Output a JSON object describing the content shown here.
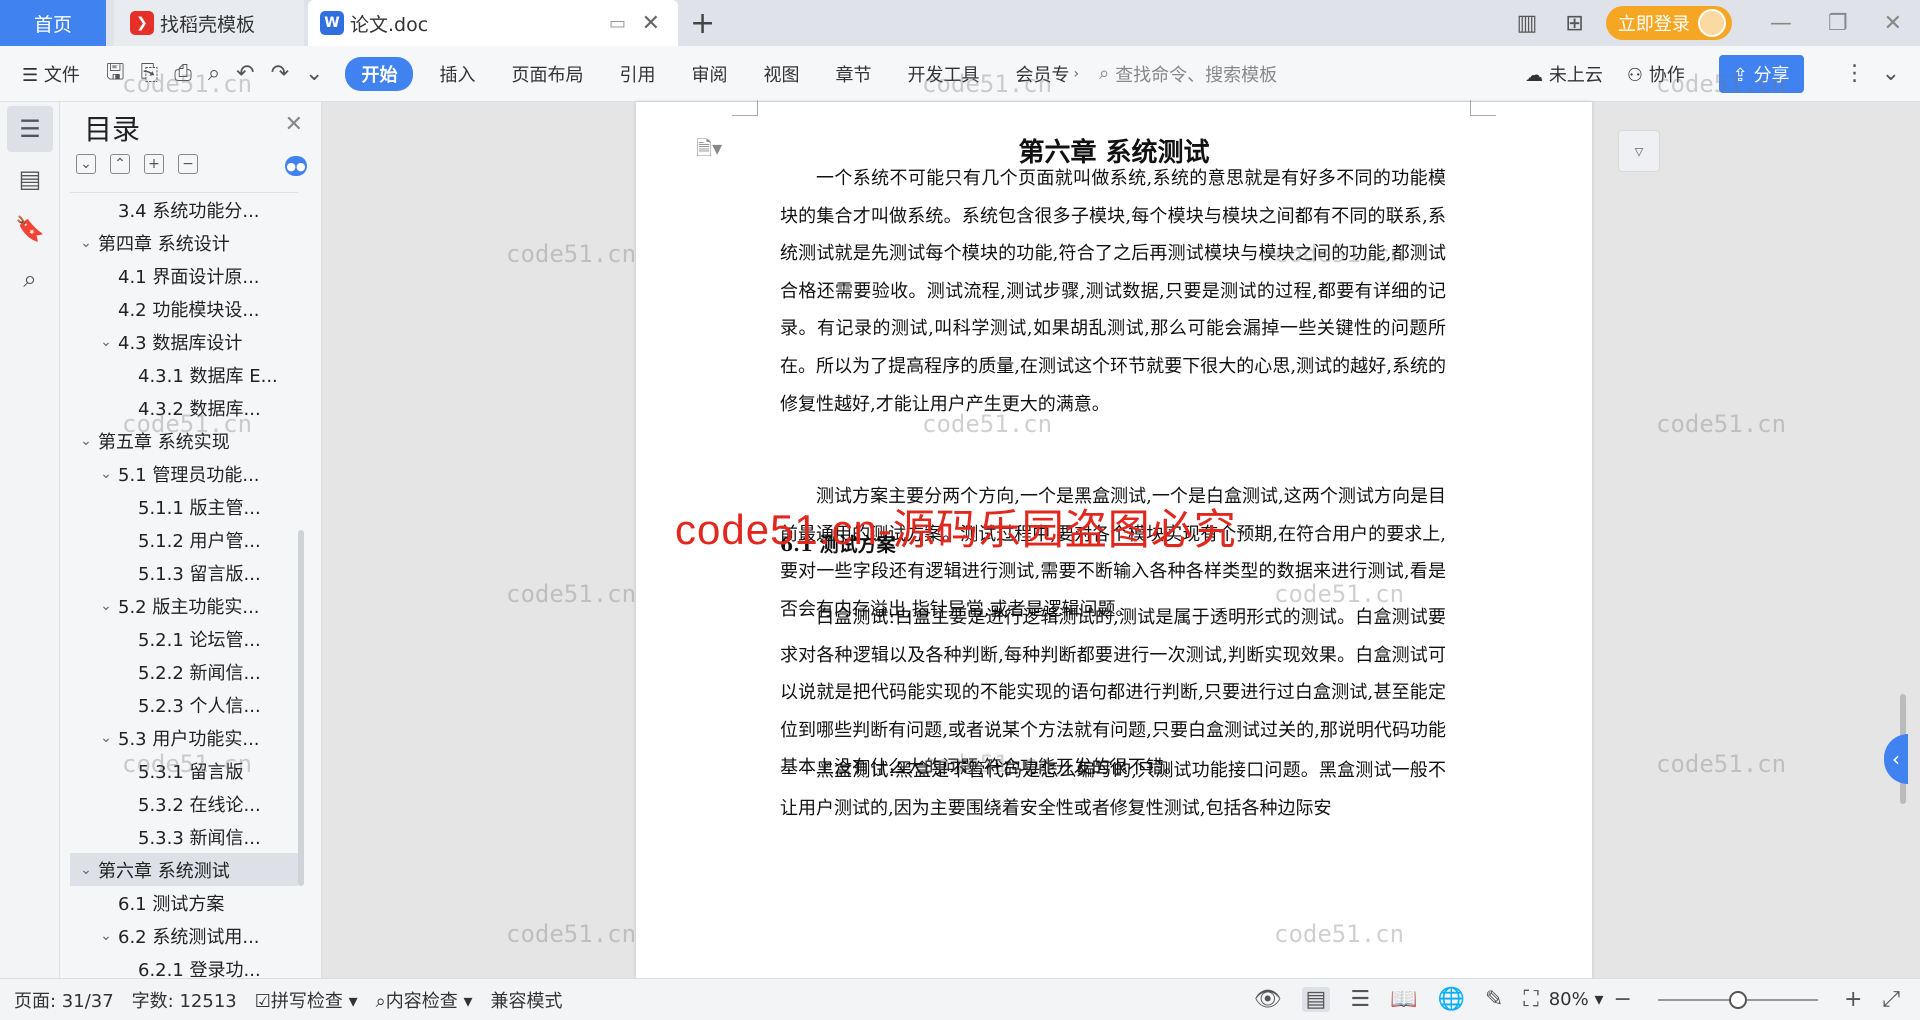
{
  "titlebar": {
    "tabs": [
      {
        "label": "首页"
      },
      {
        "label": "找稻壳模板",
        "icon": "daoke-icon"
      },
      {
        "label": "论文.doc",
        "icon": "wps-writer-icon"
      }
    ],
    "login_label": "立即登录"
  },
  "toolbar": {
    "file_label": "文件",
    "tabs": [
      "开始",
      "插入",
      "页面布局",
      "引用",
      "审阅",
      "视图",
      "章节",
      "开发工具",
      "会员专"
    ],
    "search_placeholder": "查找命令、搜索模板",
    "cloud_label": "未上云",
    "collab_label": "协作",
    "share_label": "分享"
  },
  "toc": {
    "title": "目录",
    "items": [
      {
        "label": "3.4 系统功能分...",
        "level": 2,
        "arrow": ""
      },
      {
        "label": "第四章  系统设计",
        "level": 1,
        "arrow": "v"
      },
      {
        "label": "4.1 界面设计原...",
        "level": 2,
        "arrow": ""
      },
      {
        "label": "4.2 功能模块设...",
        "level": 2,
        "arrow": ""
      },
      {
        "label": "4.3 数据库设计",
        "level": 2,
        "arrow": "v"
      },
      {
        "label": "4.3.1 数据库 E...",
        "level": 3,
        "arrow": ""
      },
      {
        "label": "4.3.2  数据库...",
        "level": 3,
        "arrow": ""
      },
      {
        "label": "第五章  系统实现",
        "level": 1,
        "arrow": "v"
      },
      {
        "label": "5.1  管理员功能...",
        "level": 2,
        "arrow": "v"
      },
      {
        "label": "5.1.1  版主管...",
        "level": 3,
        "arrow": ""
      },
      {
        "label": "5.1.2  用户管...",
        "level": 3,
        "arrow": ""
      },
      {
        "label": "5.1.3  留言版...",
        "level": 3,
        "arrow": ""
      },
      {
        "label": "5.2  版主功能实...",
        "level": 2,
        "arrow": "v"
      },
      {
        "label": "5.2.1  论坛管...",
        "level": 3,
        "arrow": ""
      },
      {
        "label": "5.2.2  新闻信...",
        "level": 3,
        "arrow": ""
      },
      {
        "label": "5.2.3  个人信...",
        "level": 3,
        "arrow": ""
      },
      {
        "label": "5.3  用户功能实...",
        "level": 2,
        "arrow": "v"
      },
      {
        "label": "5.3.1  留言版",
        "level": 3,
        "arrow": ""
      },
      {
        "label": "5.3.2  在线论...",
        "level": 3,
        "arrow": ""
      },
      {
        "label": "5.3.3  新闻信...",
        "level": 3,
        "arrow": ""
      },
      {
        "label": "第六章  系统测试",
        "level": 1,
        "arrow": "v",
        "selected": true
      },
      {
        "label": "6.1  测试方案",
        "level": 2,
        "arrow": ""
      },
      {
        "label": "6.2  系统测试用...",
        "level": 2,
        "arrow": "v"
      },
      {
        "label": "6.2.1  登录功...",
        "level": 3,
        "arrow": ""
      }
    ]
  },
  "document": {
    "chapter_title": "第六章  系统测试",
    "para1": "一个系统不可能只有几个页面就叫做系统,系统的意思就是有好多不同的功能模块的集合才叫做系统。系统包含很多子模块,每个模块与模块之间都有不同的联系,系统测试就是先测试每个模块的功能,符合了之后再测试模块与模块之间的功能,都测试合格还需要验收。测试流程,测试步骤,测试数据,只要是测试的过程,都要有详细的记录。有记录的测试,叫科学测试,如果胡乱测试,那么可能会漏掉一些关键性的问题所在。所以为了提高程序的质量,在测试这个环节就要下很大的心思,测试的越好,系统的修复性越好,才能让用户产生更大的满意。",
    "section_title": "6.1  测试方案",
    "para2": "测试方案主要分两个方向,一个是黑盒测试,一个是白盒测试,这两个测试方向是目前最通用的测试方案。测试过程中,要对各个模块实现有个预期,在符合用户的要求上,要对一些字段还有逻辑进行测试,需要不断输入各种各样类型的数据来进行测试,看是否会有内存溢出,指针异常,或者是逻辑问题。",
    "para3": "白盒测试:白盒主要是进行逻辑测试的,测试是属于透明形式的测试。白盒测试要求对各种逻辑以及各种判断,每种判断都要进行一次测试,判断实现效果。白盒测试可以说就是把代码能实现的不能实现的语句都进行判断,只要进行过白盒测试,甚至能定位到哪些判断有问题,或者说某个方法就有问题,只要白盒测试过关的,那说明代码功能基本上没有什么大的问题,符合功能开发的很不错。",
    "para4": "黑盒测试:黑盒是不管代码是怎么编写的,只测试功能接口问题。黑盒测试一般不让用户测试的,因为主要围绕着安全性或者修复性测试,包括各种边际安"
  },
  "watermark": {
    "small_text": "code51.cn",
    "big_text": "code51.cn-源码乐园盗图必究",
    "big_color": "#e0281f"
  },
  "statusbar": {
    "page": "页面: 31/37",
    "words": "字数: 12513",
    "spell": "拼写检查",
    "content": "内容检查",
    "compat": "兼容模式",
    "zoom": "80%",
    "zoom_value": 0.5
  },
  "colors": {
    "accent": "#3f82f0",
    "login": "#f5a623"
  }
}
